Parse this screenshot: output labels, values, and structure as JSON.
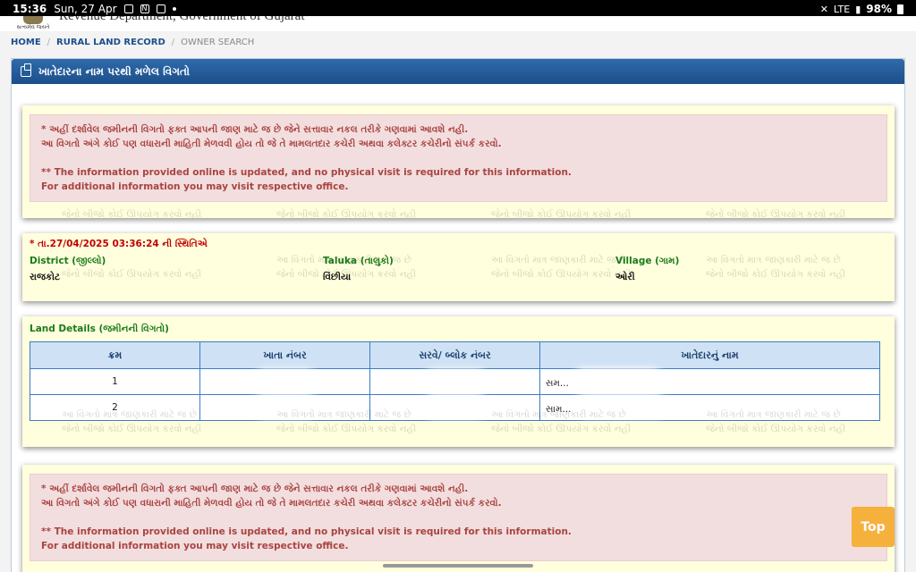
{
  "statusbar": {
    "time": "15:36",
    "date": "Sun, 27 Apr",
    "battery": "98%",
    "network": "LTE"
  },
  "header": {
    "department": "Revenue Department, Government of Gujarat",
    "motto": "સત્યમેવ જયતે"
  },
  "breadcrumb": {
    "home": "HOME",
    "rural": "RURAL LAND RECORD",
    "current": "OWNER SEARCH"
  },
  "panel": {
    "title": "ખાતેદારના નામ પરથી મળેલ વિગતો"
  },
  "notice": {
    "line1": "* અહીં દર્શાવેલ જમીનની વિગતો ફક્ત આપની જાણ માટે જ છે જેને સત્તાવાર નકલ તરીકે ગણવામાં આવશે નહી.",
    "line2": "આ વિગતો અંગે કોઈ પણ વધારાની માહિતી મેળવવી હોય તો જે તે મામલતદાર કચેરી અથવા કલેક્ટર કચેરીનો સંપર્ક કરવો.",
    "line3": "** The information provided online is updated, and no physical visit is required for this information.",
    "line4": "For additional information you may visit respective office."
  },
  "watermark": {
    "line1": "આ વિગતો માત્ર જાણકારી માટે જ છે",
    "line2": "જેનો બીજો કોઈ ઊપયોગ કરવો નહી"
  },
  "location": {
    "status": "* તા.27/04/2025 03:36:24 ની સ્થિતિએ",
    "district_label": "District (જીલ્લો)",
    "district_value": "રાજકોટ",
    "taluka_label": "Taluka (તાલુકો)",
    "taluka_value": "વિંછીયા",
    "village_label": "Village (ગામ)",
    "village_value": "ઓરી"
  },
  "land": {
    "title": "Land Details (જમીનની વિગતો)",
    "columns": [
      "ક્રમ",
      "ખાતા નંબર",
      "સરવે/ બ્લોક નંબર",
      "ખાતેદારનું નામ"
    ],
    "rows": [
      {
        "sr": "1",
        "owner": "સમ..."
      },
      {
        "sr": "2",
        "owner": "સામ..."
      }
    ]
  },
  "top_button": "Top"
}
